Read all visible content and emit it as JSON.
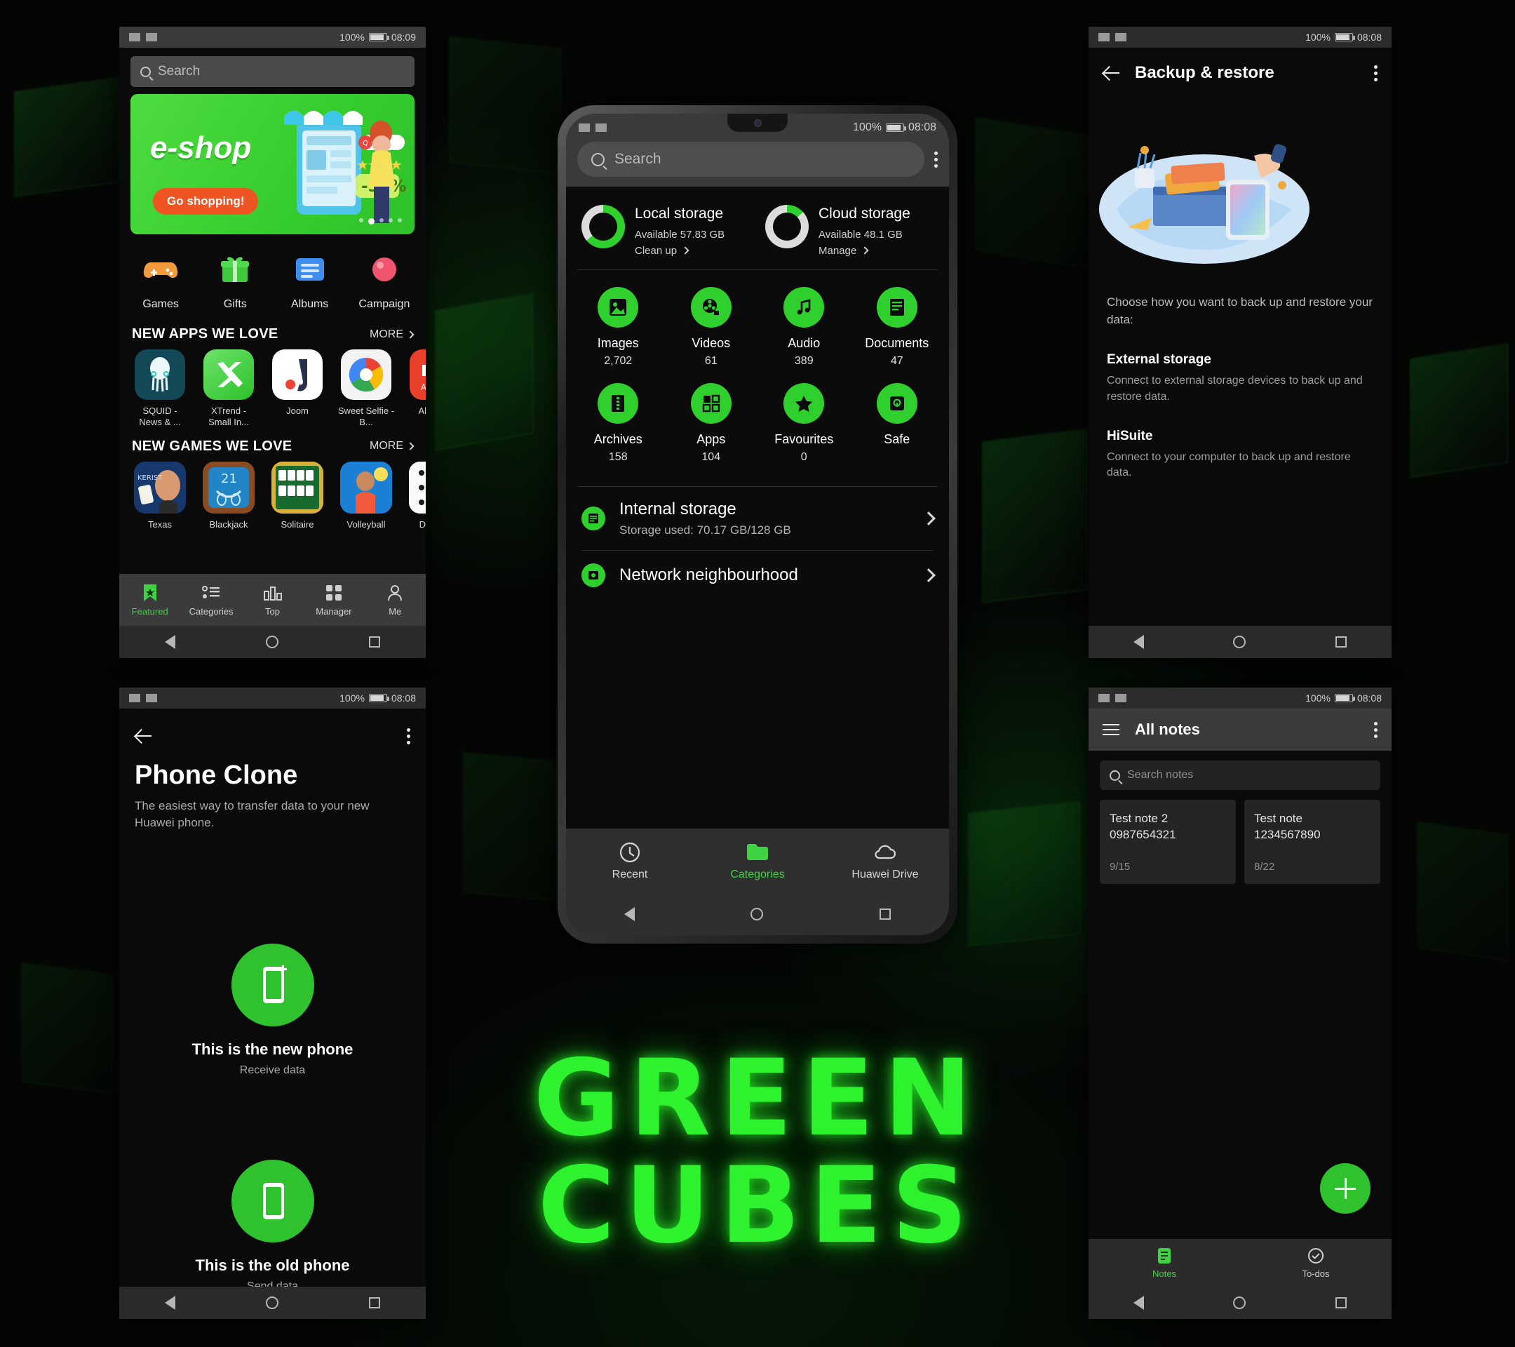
{
  "statusbar": {
    "battery": "100%",
    "time": "08:08",
    "time_alt": "08:09"
  },
  "appgallery": {
    "search_placeholder": "Search",
    "banner": {
      "title": "e-shop",
      "cta": "Go shopping!",
      "discount": "-50%"
    },
    "quick": [
      {
        "label": "Games",
        "icon": "gamepad-icon"
      },
      {
        "label": "Gifts",
        "icon": "gift-icon"
      },
      {
        "label": "Albums",
        "icon": "album-icon"
      },
      {
        "label": "Campaign",
        "icon": "campaign-icon"
      }
    ],
    "sections": [
      {
        "title": "NEW APPS WE LOVE",
        "more": "MORE",
        "items": [
          {
            "name": "SQUID - News & ..."
          },
          {
            "name": "XTrend - Small In..."
          },
          {
            "name": "Joom"
          },
          {
            "name": "Sweet Selfie - B..."
          },
          {
            "name": "Aliexpre"
          }
        ]
      },
      {
        "title": "NEW GAMES WE LOVE",
        "more": "MORE",
        "items": [
          {
            "name": "Texas"
          },
          {
            "name": "Blackjack"
          },
          {
            "name": "Solitaire"
          },
          {
            "name": "Volleyball"
          },
          {
            "name": "Domino"
          }
        ]
      }
    ],
    "tabs": [
      {
        "label": "Featured",
        "icon": "bookmark-star-icon",
        "active": true
      },
      {
        "label": "Categories",
        "icon": "list-icon",
        "active": false
      },
      {
        "label": "Top",
        "icon": "chart-bars-icon",
        "active": false
      },
      {
        "label": "Manager",
        "icon": "grid-icon",
        "active": false
      },
      {
        "label": "Me",
        "icon": "person-icon",
        "active": false
      }
    ]
  },
  "phoneclone": {
    "title": "Phone Clone",
    "subtitle": "The easiest way to transfer data to your new Huawei phone.",
    "options": [
      {
        "title": "This is the new phone",
        "sub": "Receive data",
        "icon": "phone-plus-icon"
      },
      {
        "title": "This is the old phone",
        "sub": "Send data",
        "icon": "phone-icon"
      }
    ]
  },
  "backup": {
    "title": "Backup & restore",
    "intro": "Choose how you want to back up and restore your data:",
    "items": [
      {
        "title": "External storage",
        "desc": "Connect to external storage devices to back up and restore data."
      },
      {
        "title": "HiSuite",
        "desc": "Connect to your computer to back up and restore data."
      }
    ]
  },
  "notes": {
    "title": "All notes",
    "search_placeholder": "Search notes",
    "cards": [
      {
        "body": "Test note 2\n0987654321",
        "date": "9/15"
      },
      {
        "body": "Test note\n1234567890",
        "date": "8/22"
      }
    ],
    "tabs": [
      {
        "label": "Notes",
        "icon": "notes-icon",
        "active": true
      },
      {
        "label": "To-dos",
        "icon": "check-circle-icon",
        "active": false
      }
    ]
  },
  "filemanager": {
    "search_placeholder": "Search",
    "storage": [
      {
        "name": "Local storage",
        "available": "Available 57.83 GB",
        "action": "Clean up"
      },
      {
        "name": "Cloud storage",
        "available": "Available 48.1 GB",
        "action": "Manage"
      }
    ],
    "categories": [
      {
        "label": "Images",
        "count": "2,702",
        "icon": "image-icon"
      },
      {
        "label": "Videos",
        "count": "61",
        "icon": "film-icon"
      },
      {
        "label": "Audio",
        "count": "389",
        "icon": "music-icon"
      },
      {
        "label": "Documents",
        "count": "47",
        "icon": "document-icon"
      },
      {
        "label": "Archives",
        "count": "158",
        "icon": "archive-zip-icon"
      },
      {
        "label": "Apps",
        "count": "104",
        "icon": "grid-apps-icon"
      },
      {
        "label": "Favourites",
        "count": "0",
        "icon": "star-icon"
      },
      {
        "label": "Safe",
        "count": "",
        "icon": "safe-lock-icon"
      }
    ],
    "rows": [
      {
        "title": "Internal storage",
        "sub": "Storage used: 70.17 GB/128 GB",
        "icon": "storage-icon"
      },
      {
        "title": "Network neighbourhood",
        "sub": "",
        "icon": "network-icon"
      }
    ],
    "tabs": [
      {
        "label": "Recent",
        "icon": "clock-icon",
        "active": false
      },
      {
        "label": "Categories",
        "icon": "folder-icon",
        "active": true
      },
      {
        "label": "Huawei Drive",
        "icon": "cloud-icon",
        "active": false
      }
    ]
  },
  "wordmark": {
    "line1": "GREEN",
    "line2": "CUBES",
    "color": "#2ef22e"
  }
}
